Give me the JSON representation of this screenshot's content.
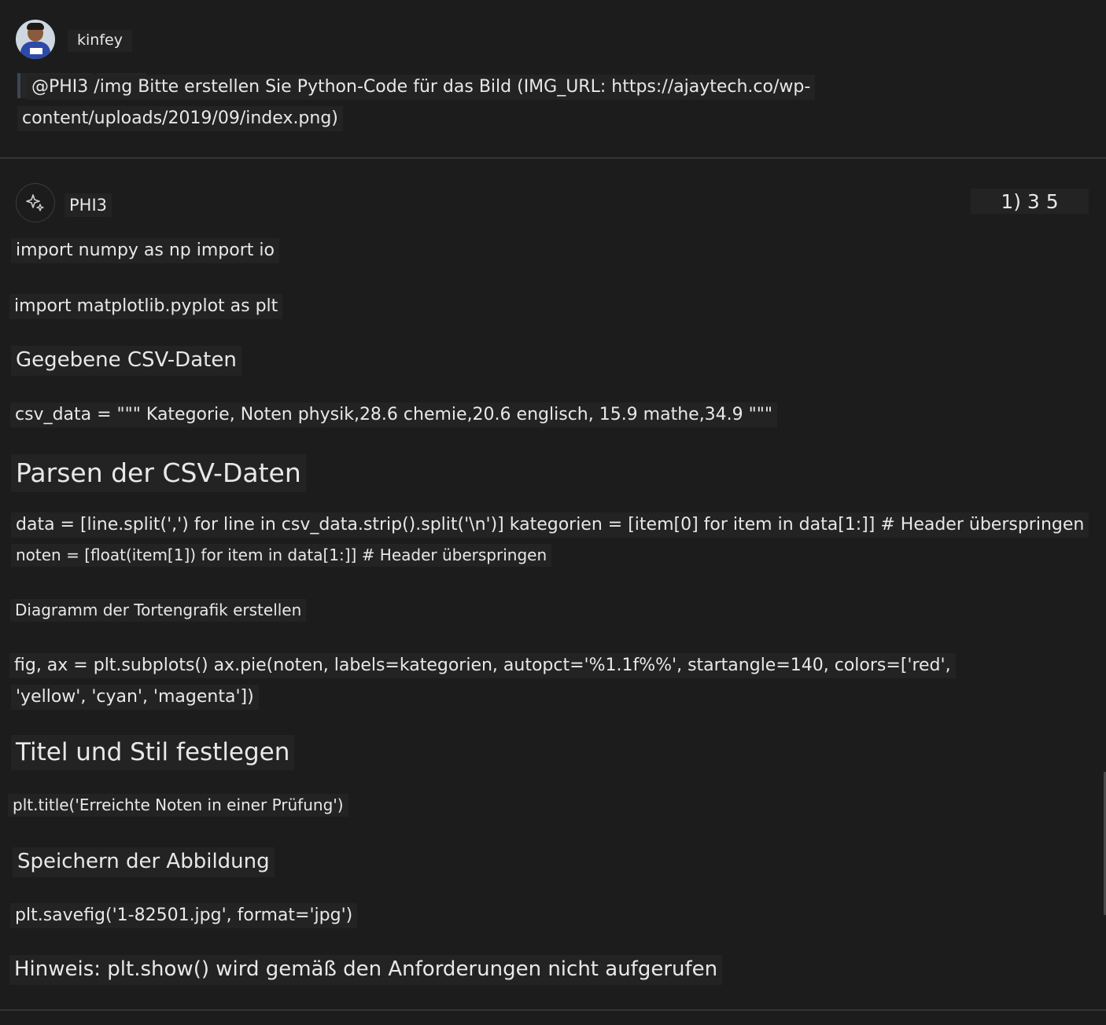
{
  "user": {
    "name": "kinfey",
    "message_line1": "@PHI3 /img Bitte erstellen Sie Python-Code für das Bild (IMG_URL: https://ajaytech.co/wp-",
    "message_line2": "content/uploads/2019/09/index.png)"
  },
  "assistant": {
    "name": "PHI3",
    "icon": "sparkle-icon",
    "counter": "1) 3 5",
    "lines": [
      "import numpy as np import io",
      "import matplotlib.pyplot as plt",
      "Gegebene CSV-Daten",
      "csv_data = \"\"\" Kategorie, Noten physik,28.6 chemie,20.6 englisch, 15.9 mathe,34.9 \"\"\"",
      "Parsen der CSV-Daten",
      "data = [line.split(',') for line in csv_data.strip().split('\\n')] kategorien = [item[0] for item in data[1:]] # Header überspringen",
      "noten = [float(item[1]) for item in data[1:]] # Header überspringen",
      "Diagramm der Tortengrafik erstellen",
      "fig, ax = plt.subplots() ax.pie(noten, labels=kategorien, autopct='%1.1f%%', startangle=140, colors=['red',",
      "'yellow', 'cyan', 'magenta'])",
      "Titel und Stil festlegen",
      "plt.title('Erreichte Noten in einer Prüfung')",
      "Speichern der Abbildung",
      "plt.savefig('1-82501.jpg', format='jpg')",
      "Hinweis: plt.show() wird gemäß den Anforderungen nicht aufgerufen"
    ]
  }
}
